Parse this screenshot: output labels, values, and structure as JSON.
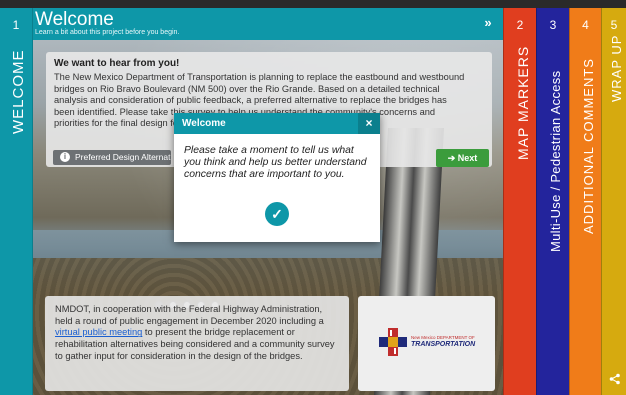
{
  "tabs": [
    {
      "number": "1",
      "label": "WELCOME"
    },
    {
      "number": "2",
      "label": "MAP MARKERS"
    },
    {
      "number": "3",
      "label": "Multi-Use / Pedestrian Access"
    },
    {
      "number": "4",
      "label": "ADDITIONAL COMMENTS"
    },
    {
      "number": "5",
      "label": "WRAP UP"
    }
  ],
  "header": {
    "title": "Welcome",
    "subtitle": "Learn a bit about this project before you begin.",
    "next_icon": "»"
  },
  "intro": {
    "heading": "We want to hear from you!",
    "text": "The New Mexico Department of Transportation is planning to replace the eastbound and westbound bridges on Rio Bravo Boulevard (NM 500) over the Rio Grande. Based on a detailed technical analysis and consideration of public feedback, a preferred alternative to replace the bridges has been identified. Please take this survey to help us understand the community's concerns and priorities for the final design for the bridge.",
    "pref_button": "Preferred Design Alternative",
    "next_button": "Next"
  },
  "bottom": {
    "text_before": "NMDOT, in cooperation with the Federal Highway Administration, held a round of public engagement in December 2020 including a ",
    "link": "virtual public meeting",
    "text_after": " to present the bridge replacement or rehabilitation alternatives being considered and a community survey to gather input for consideration in the design of the bridges."
  },
  "logo": {
    "line1": "New Mexico DEPARTMENT OF",
    "line2": "TRANSPORTATION"
  },
  "modal": {
    "title": "Welcome",
    "close": "×",
    "body": "Please take a moment to tell us what you think and help us better understand concerns that are important to you.",
    "check": "✓"
  },
  "colors": {
    "teal": "#0e97a8",
    "red": "#e03e1f",
    "navy": "#23249c",
    "orange": "#f07c19",
    "yellow": "#d6aa0f",
    "green": "#3b9c3c"
  },
  "icons": [
    "chevrons-right-icon",
    "info-icon",
    "arrow-right-icon",
    "close-icon",
    "check-circle-icon",
    "share-icon"
  ],
  "carousel": {
    "total": 5,
    "active": 1
  }
}
